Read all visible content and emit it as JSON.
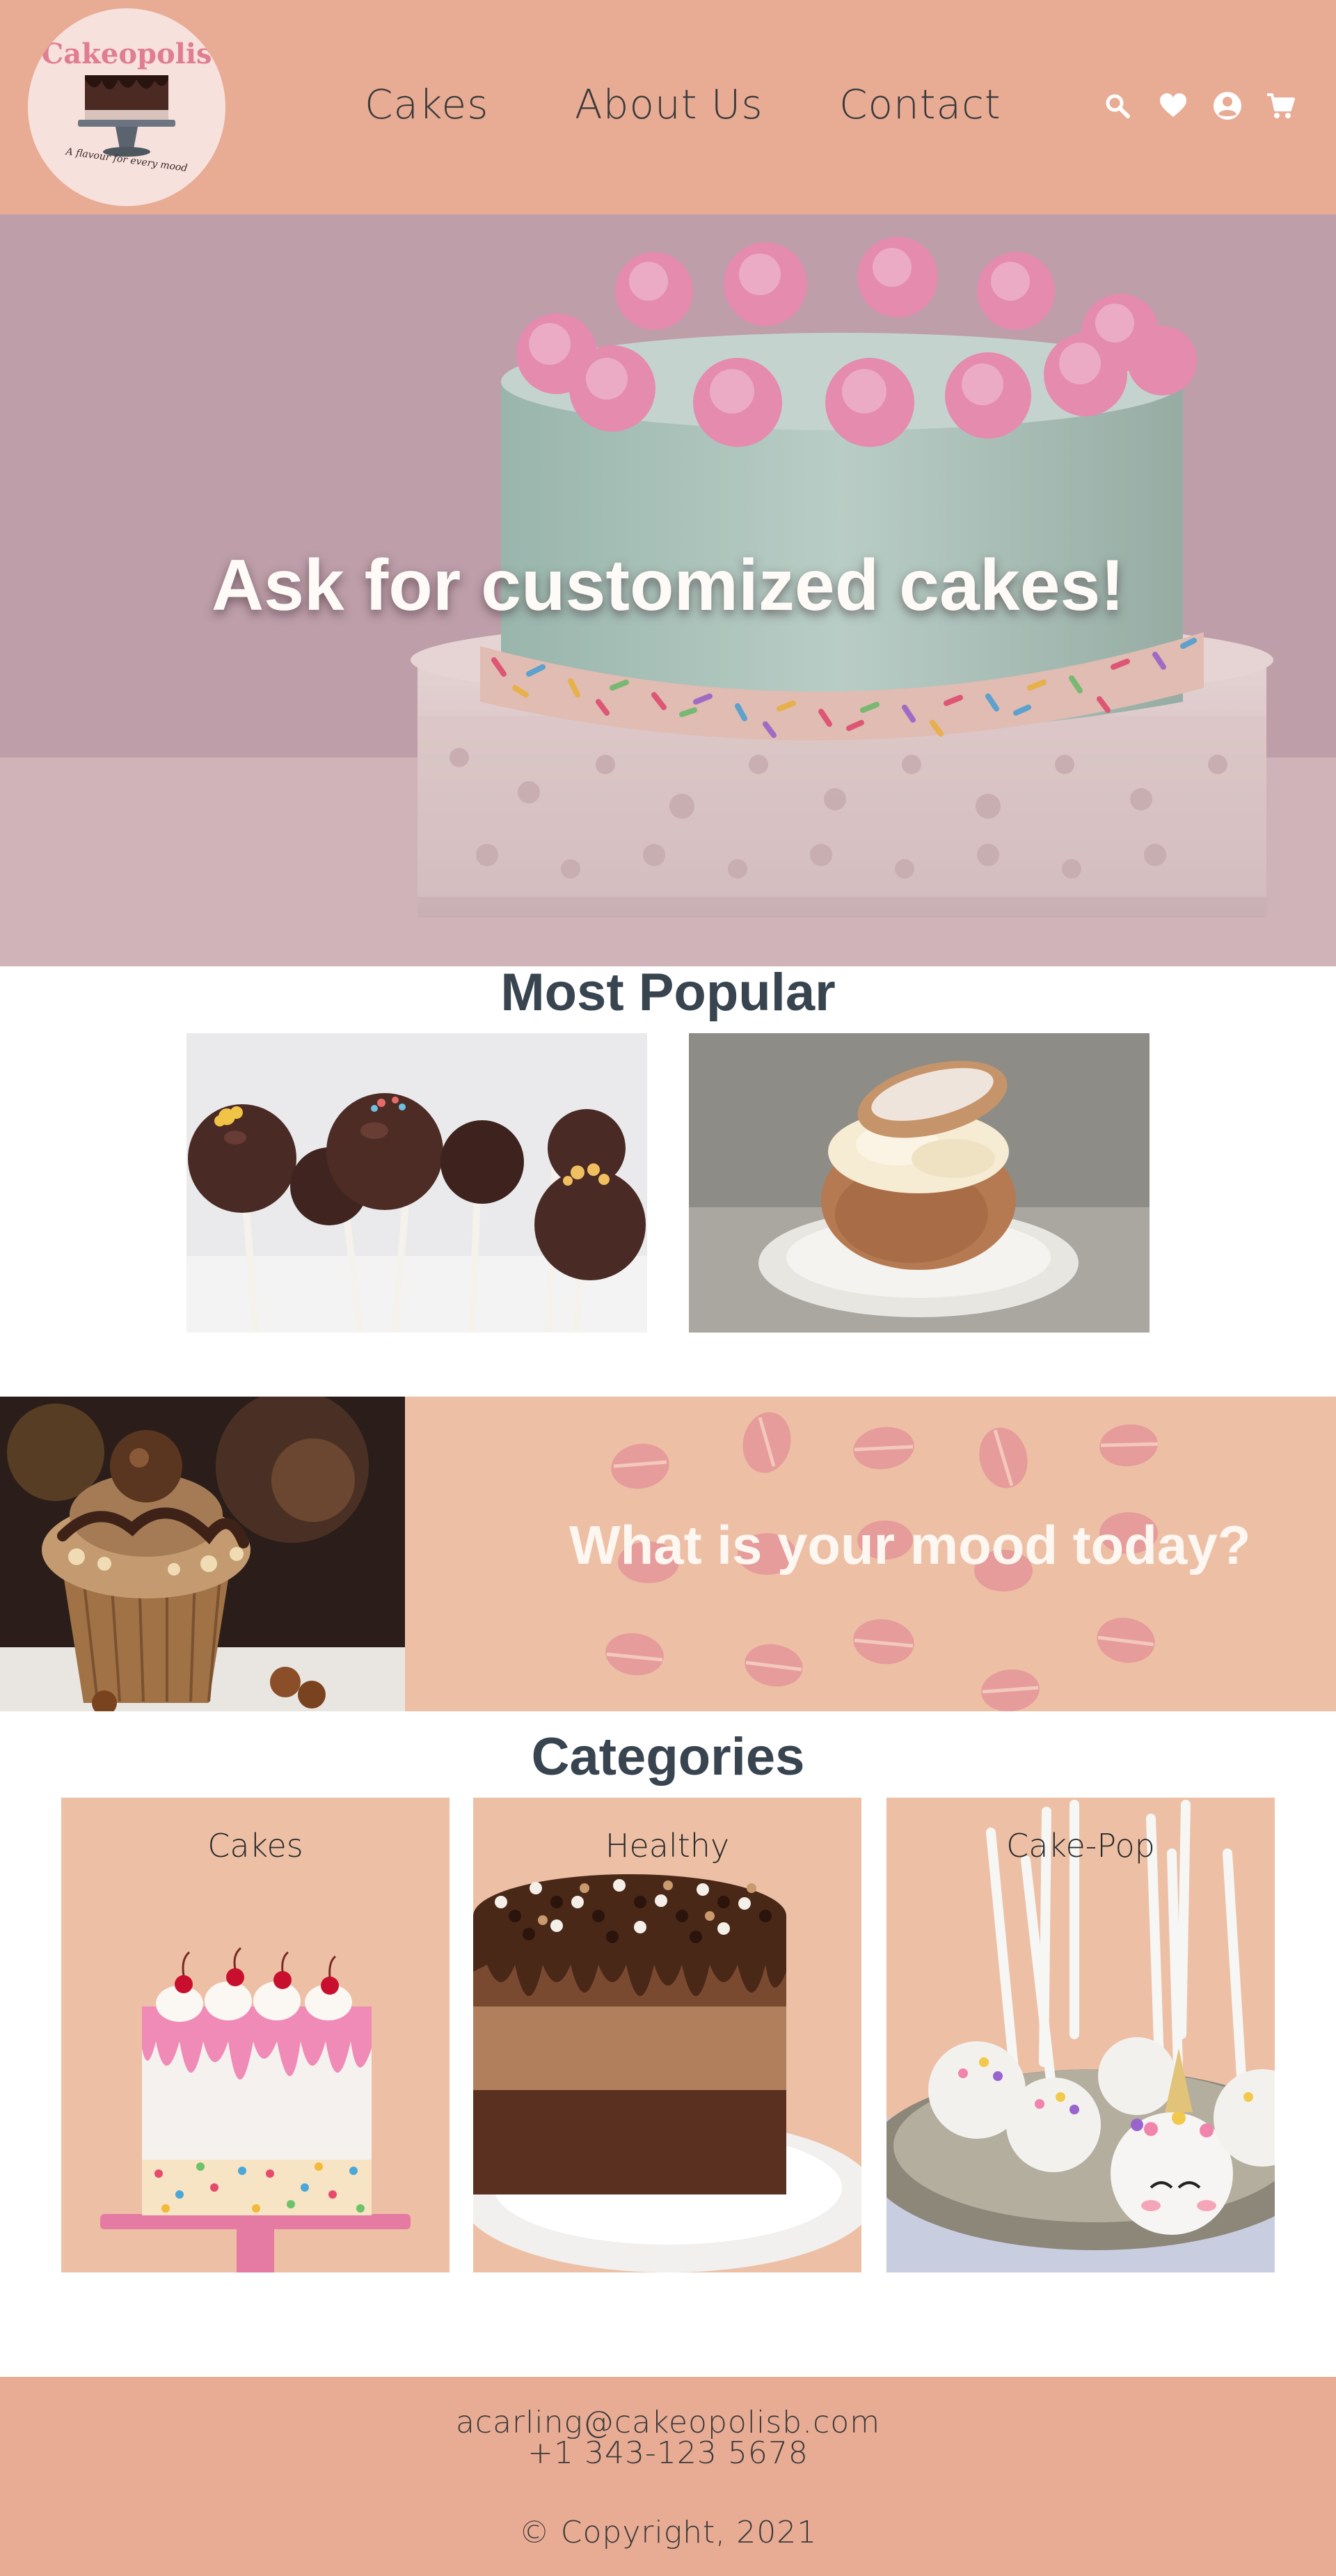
{
  "brand": {
    "name": "Cakeopolis",
    "tagline": "A flavour for every mood",
    "colors": {
      "header": "#e8ab94",
      "panel": "#edc0a6",
      "heading": "#38444f"
    }
  },
  "nav": {
    "items": [
      {
        "label": "Cakes"
      },
      {
        "label": "About Us"
      },
      {
        "label": "Contact"
      }
    ],
    "icons": [
      "search-icon",
      "heart-icon",
      "user-icon",
      "cart-icon"
    ]
  },
  "hero": {
    "title": "Ask for customized cakes!"
  },
  "popular": {
    "title": "Most Popular",
    "items": [
      "cake-pops",
      "cream-bun"
    ]
  },
  "mood": {
    "text": "What is your mood today?"
  },
  "categories": {
    "title": "Categories",
    "items": [
      {
        "label": "Cakes"
      },
      {
        "label": "Healthy"
      },
      {
        "label": "Cake-Pop"
      }
    ]
  },
  "footer": {
    "email": "acarling@cakeopolisb.com",
    "phone": "+1 343-123 5678",
    "copyright": "© Copyright, 2021"
  }
}
